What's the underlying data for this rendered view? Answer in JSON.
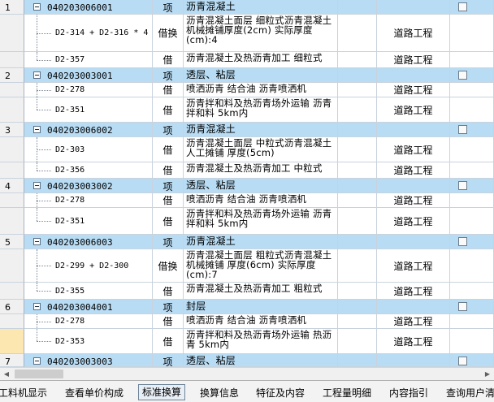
{
  "rows": [
    {
      "kind": "head",
      "no": "1",
      "code": "040203006001",
      "type": "项",
      "name": "沥青混凝土",
      "spec": ""
    },
    {
      "kind": "child",
      "no": "",
      "code": "D2-314 + D2-316 * 4",
      "type": "借换",
      "name": "沥青混凝土面层 细粒式沥青混凝土 机械摊铺厚度(2cm) 实际厚度(cm):4",
      "spec": "道路工程"
    },
    {
      "kind": "child",
      "no": "",
      "code": "D2-357",
      "type": "借",
      "name": "沥青混凝土及热沥青加工 细粒式",
      "spec": "道路工程"
    },
    {
      "kind": "head",
      "no": "2",
      "code": "040203003001",
      "type": "项",
      "name": "透层、粘层",
      "spec": ""
    },
    {
      "kind": "child",
      "no": "",
      "code": "D2-278",
      "type": "借",
      "name": "喷洒沥青 结合油 沥青喷洒机",
      "spec": "道路工程"
    },
    {
      "kind": "child",
      "no": "",
      "code": "D2-351",
      "type": "借",
      "name": "沥青拌和料及热沥青场外运输 沥青拌和料 5km内",
      "spec": "道路工程"
    },
    {
      "kind": "head",
      "no": "3",
      "code": "040203006002",
      "type": "项",
      "name": "沥青混凝土",
      "spec": ""
    },
    {
      "kind": "child",
      "no": "",
      "code": "D2-303",
      "type": "借",
      "name": "沥青混凝土面层 中粒式沥青混凝土 人工摊铺 厚度(5cm)",
      "spec": "道路工程"
    },
    {
      "kind": "child",
      "no": "",
      "code": "D2-356",
      "type": "借",
      "name": "沥青混凝土及热沥青加工 中粒式",
      "spec": "道路工程"
    },
    {
      "kind": "head",
      "no": "4",
      "code": "040203003002",
      "type": "项",
      "name": "透层、粘层",
      "spec": ""
    },
    {
      "kind": "child",
      "no": "",
      "code": "D2-278",
      "type": "借",
      "name": "喷洒沥青 结合油 沥青喷洒机",
      "spec": "道路工程"
    },
    {
      "kind": "child",
      "no": "",
      "code": "D2-351",
      "type": "借",
      "name": "沥青拌和料及热沥青场外运输 沥青拌和料 5km内",
      "spec": "道路工程"
    },
    {
      "kind": "head",
      "no": "5",
      "code": "040203006003",
      "type": "项",
      "name": "沥青混凝土",
      "spec": ""
    },
    {
      "kind": "child",
      "no": "",
      "code": "D2-299 + D2-300",
      "type": "借换",
      "name": "沥青混凝土面层 粗粒式沥青混凝土 机械摊铺 厚度(6cm) 实际厚度(cm):7",
      "spec": "道路工程"
    },
    {
      "kind": "child",
      "no": "",
      "code": "D2-355",
      "type": "借",
      "name": "沥青混凝土及热沥青加工 粗粒式",
      "spec": "道路工程"
    },
    {
      "kind": "head",
      "no": "6",
      "code": "040203004001",
      "type": "项",
      "name": "封层",
      "spec": ""
    },
    {
      "kind": "child",
      "no": "",
      "code": "D2-278",
      "type": "借",
      "name": "喷洒沥青 结合油 沥青喷洒机",
      "spec": "道路工程"
    },
    {
      "kind": "child",
      "no": "",
      "code": "D2-353",
      "type": "借",
      "name": "沥青拌和料及热沥青场外运输 热沥青 5km内",
      "spec": "道路工程",
      "selected": true
    },
    {
      "kind": "head",
      "no": "7",
      "code": "040203003003",
      "type": "项",
      "name": "透层、粘层",
      "spec": ""
    }
  ],
  "tabs": [
    {
      "label": "工料机显示",
      "name": "tab-labor-material-machine"
    },
    {
      "label": "查看单价构成",
      "name": "tab-unit-price-composition"
    },
    {
      "label": "标准换算",
      "name": "tab-standard-conversion",
      "active": true
    },
    {
      "label": "换算信息",
      "name": "tab-conversion-info"
    },
    {
      "label": "特征及内容",
      "name": "tab-features-content"
    },
    {
      "label": "工程量明细",
      "name": "tab-quantity-detail"
    },
    {
      "label": "内容指引",
      "name": "tab-content-guide"
    },
    {
      "label": "查询用户清",
      "name": "tab-query-user-list"
    }
  ],
  "colors": {
    "head_row": "#b8dcf4",
    "grid_line": "#c9d3dd",
    "selected_row_number": "#fde7b0"
  }
}
